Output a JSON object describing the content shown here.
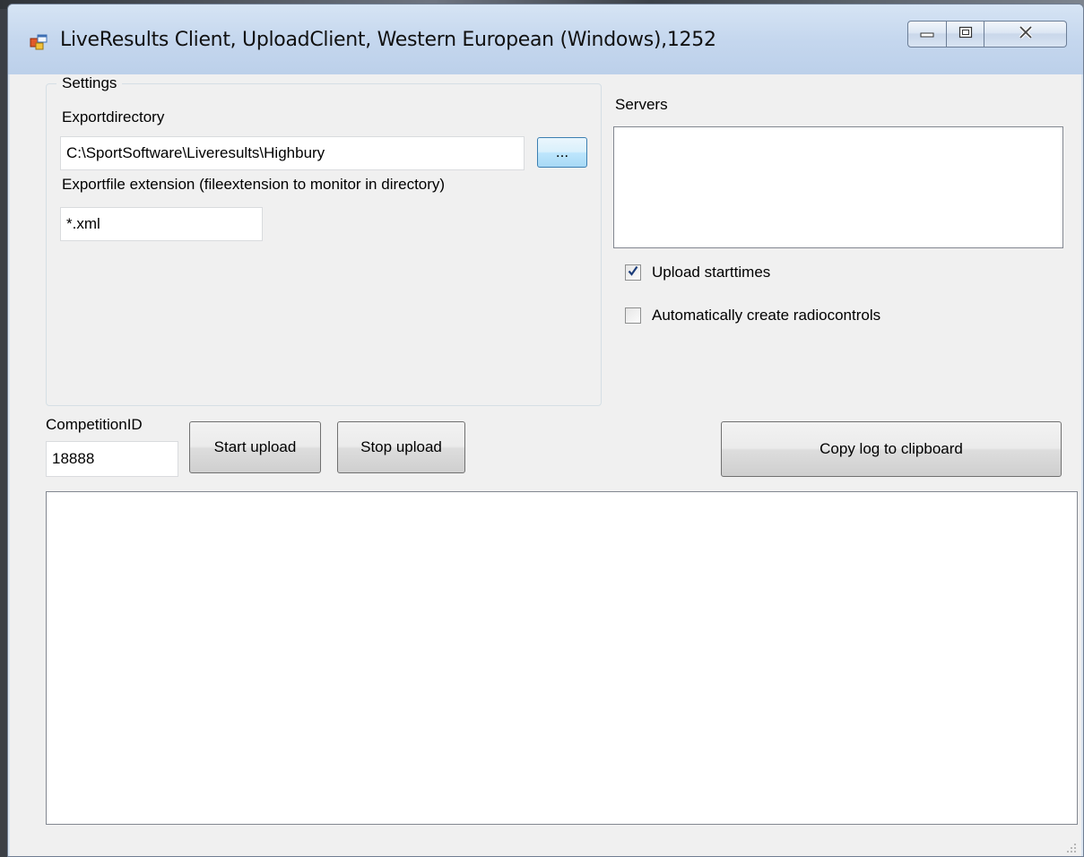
{
  "window": {
    "title": "LiveResults Client, UploadClient, Western European (Windows),1252"
  },
  "settings": {
    "group_label": "Settings",
    "export_directory_label": "Exportdirectory",
    "export_directory_value": "C:\\SportSoftware\\Liveresults\\Highbury",
    "browse_label": "...",
    "extension_label": "Exportfile extension (fileextension to monitor in directory)",
    "extension_value": "*.xml"
  },
  "servers": {
    "label": "Servers",
    "items": []
  },
  "options": {
    "upload_starttimes_label": "Upload starttimes",
    "upload_starttimes_checked": true,
    "auto_radiocontrols_label": "Automatically create radiocontrols",
    "auto_radiocontrols_checked": false
  },
  "competition": {
    "label": "CompetitionID",
    "value": "18888"
  },
  "actions": {
    "start_label": "Start upload",
    "stop_label": "Stop upload",
    "copy_log_label": "Copy log to clipboard"
  },
  "icons": {
    "app": "app-window-icon",
    "minimize": "minimize-icon",
    "maximize": "maximize-icon",
    "close": "close-icon",
    "check": "checkmark-icon",
    "grip": "resize-grip-icon"
  },
  "colors": {
    "titlebar": "#c5d7ee",
    "client_bg": "#f0f0f0",
    "browse_button": "#bee6fd",
    "check_mark": "#1c3d7a"
  }
}
